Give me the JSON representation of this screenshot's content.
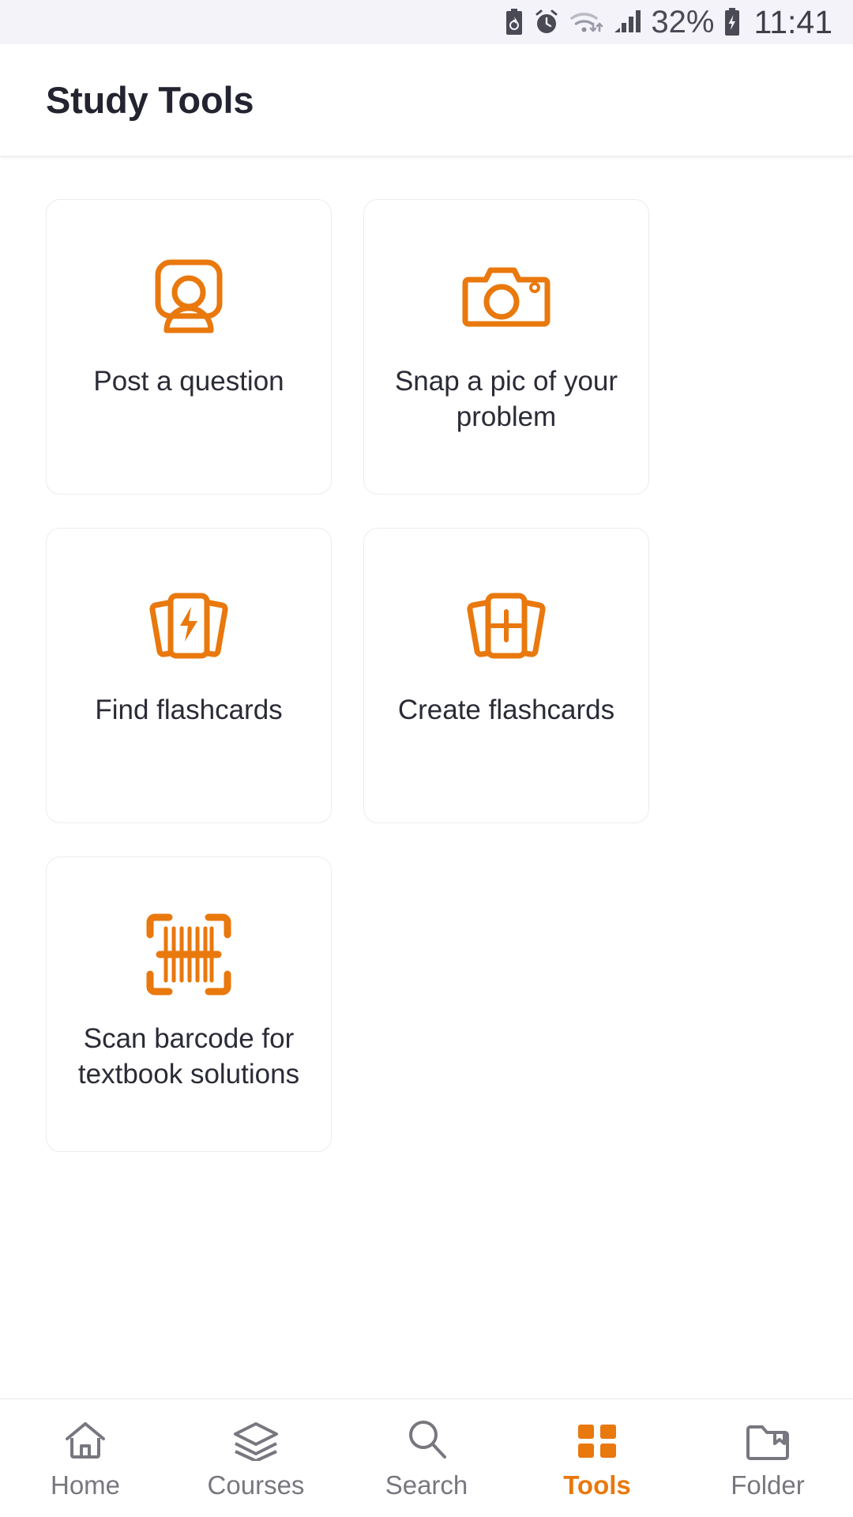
{
  "status_bar": {
    "icons": [
      "battery-saver-icon",
      "alarm-icon",
      "wifi-icon",
      "signal-icon"
    ],
    "battery_percent": "32%",
    "battery_icon": "battery-charging-icon",
    "time": "11:41"
  },
  "app_bar": {
    "title": "Study Tools"
  },
  "theme": {
    "accent": "#e9780d",
    "text": "#2a2b36",
    "muted": "#77777f",
    "card_border": "#ececec",
    "status_bg": "#f4f3fa"
  },
  "tools": [
    {
      "label": "Post a question",
      "icon": "post-question-icon"
    },
    {
      "label": "Snap a pic of your problem",
      "icon": "camera-icon"
    },
    {
      "label": "Find flashcards",
      "icon": "flashcards-lightning-icon"
    },
    {
      "label": "Create flashcards",
      "icon": "flashcards-plus-icon"
    },
    {
      "label": "Scan barcode for textbook solutions",
      "icon": "barcode-scan-icon"
    }
  ],
  "bottom_nav": {
    "items": [
      {
        "label": "Home",
        "icon": "home-icon",
        "active": false
      },
      {
        "label": "Courses",
        "icon": "layers-icon",
        "active": false
      },
      {
        "label": "Search",
        "icon": "search-icon",
        "active": false
      },
      {
        "label": "Tools",
        "icon": "grid-icon",
        "active": true
      },
      {
        "label": "Folder",
        "icon": "folder-icon",
        "active": false
      }
    ]
  }
}
